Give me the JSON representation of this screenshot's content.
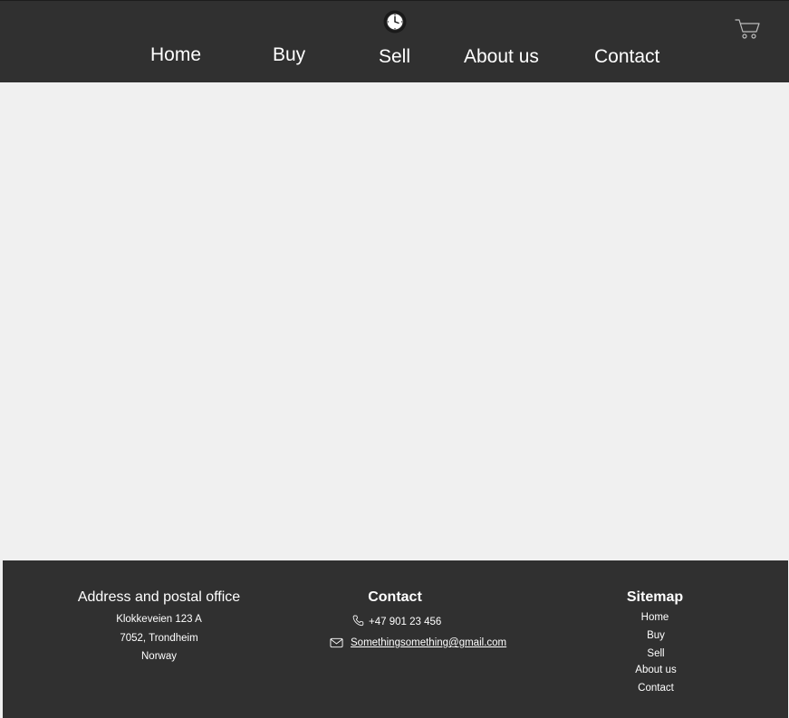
{
  "header": {
    "logo_icon": "clock-icon",
    "cart_icon": "shopping-cart-icon",
    "nav": {
      "home": "Home",
      "buy": "Buy",
      "sell": "Sell",
      "about": "About us",
      "contact": "Contact"
    }
  },
  "footer": {
    "address": {
      "title": "Address and postal office",
      "line1": "Klokkeveien 123 A",
      "line2": "7052, Trondheim",
      "line3": "Norway"
    },
    "contact": {
      "title": "Contact",
      "phone_icon": "phone-icon",
      "phone": "+47 901 23 456",
      "email_icon": "mail-icon",
      "email": "Somethingsomething@gmail.com"
    },
    "sitemap": {
      "title": "Sitemap",
      "home": "Home",
      "buy": "Buy",
      "sell": "Sell",
      "about": "About us",
      "contact": "Contact"
    }
  },
  "colors": {
    "bar": "#303030",
    "body": "#f0f0f0",
    "text": "#ffffff"
  }
}
